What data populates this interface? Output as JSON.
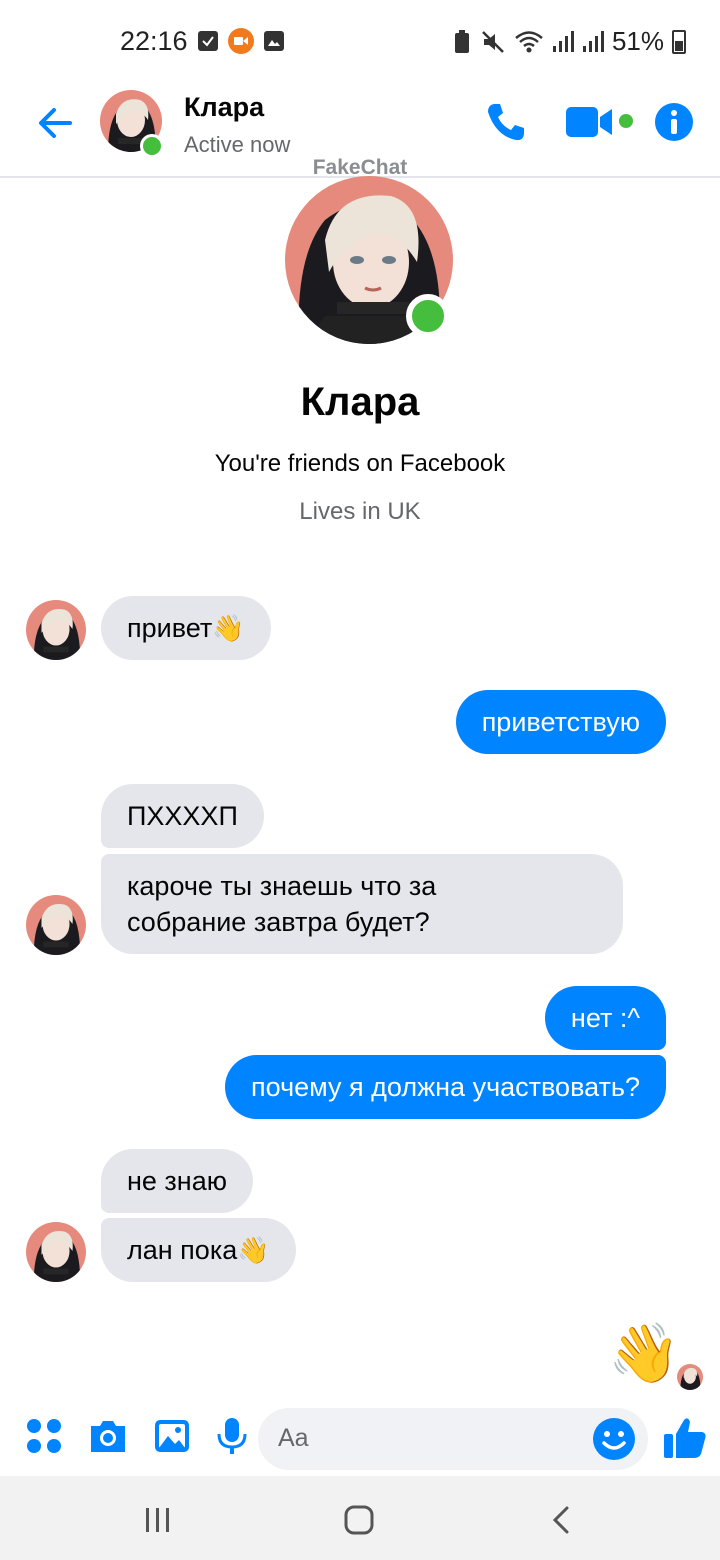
{
  "status_bar": {
    "time": "22:16",
    "battery": "51%"
  },
  "header": {
    "name": "Клара",
    "status": "Active now"
  },
  "watermark": "FakeChat",
  "profile": {
    "name": "Клара",
    "friends_text": "You're friends on Facebook",
    "location": "Lives in UK"
  },
  "messages": [
    {
      "side": "in",
      "text": "привет",
      "emoji": "👋"
    },
    {
      "side": "out",
      "text": "приветствую"
    },
    {
      "side": "in",
      "text": "ПХХХХП"
    },
    {
      "side": "in",
      "text": "кароче ты знаешь что за",
      "text2": "собрание завтра будет?"
    },
    {
      "side": "out",
      "text": "нет :^"
    },
    {
      "side": "out",
      "text": "почему я должна участвовать?"
    },
    {
      "side": "in",
      "text": "не знаю"
    },
    {
      "side": "in",
      "text": "лан пока",
      "emoji": "👋"
    }
  ],
  "big_wave": "👋",
  "composer": {
    "placeholder": "Aa"
  },
  "colors": {
    "accent": "#0084ff",
    "online": "#45bd3d",
    "incoming_bubble": "#e4e6eb"
  }
}
